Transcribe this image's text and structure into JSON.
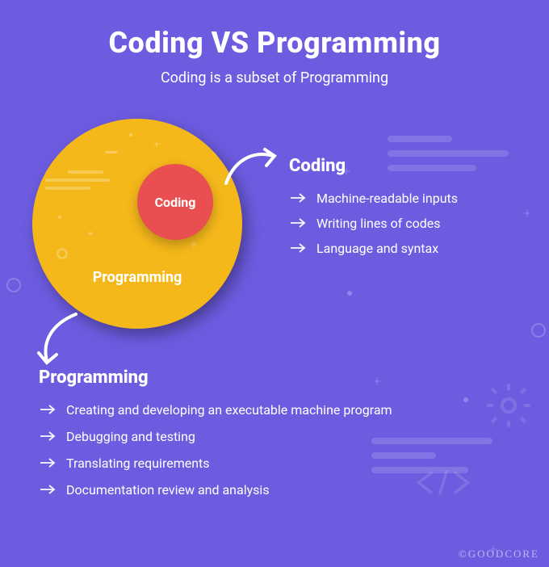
{
  "header": {
    "title": "Coding VS Programming",
    "subtitle": "Coding is a subset of Programming"
  },
  "venn": {
    "inner_label": "Coding",
    "outer_label": "Programming"
  },
  "coding": {
    "heading": "Coding",
    "items": [
      "Machine-readable inputs",
      "Writing lines of codes",
      "Language and syntax"
    ]
  },
  "programming": {
    "heading": "Programming",
    "items": [
      "Creating and developing an executable machine program",
      "Debugging and testing",
      "Translating requirements",
      "Documentation review and analysis"
    ]
  },
  "watermark": "©GOODCORE",
  "colors": {
    "background": "#6D5CE0",
    "outer_circle": "#F5B81B",
    "inner_circle": "#E94E50",
    "text": "#FFFFFF"
  }
}
